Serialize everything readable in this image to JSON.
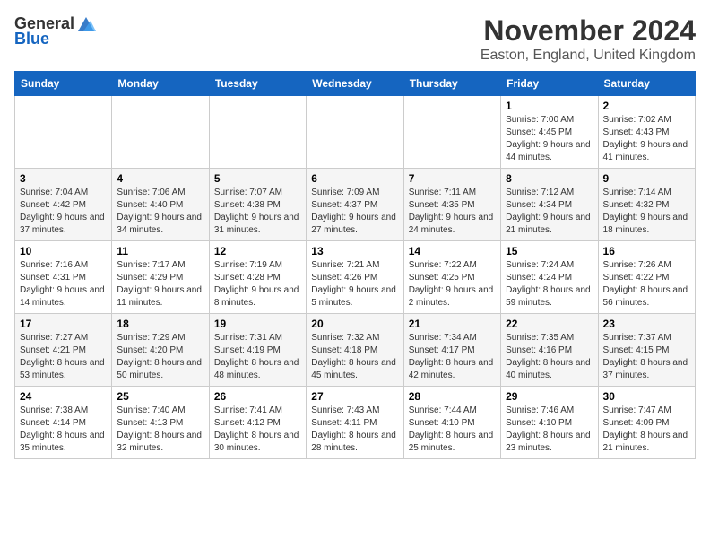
{
  "logo": {
    "general": "General",
    "blue": "Blue"
  },
  "header": {
    "month_year": "November 2024",
    "location": "Easton, England, United Kingdom"
  },
  "days_of_week": [
    "Sunday",
    "Monday",
    "Tuesday",
    "Wednesday",
    "Thursday",
    "Friday",
    "Saturday"
  ],
  "weeks": [
    [
      {
        "day": "",
        "sunrise": "",
        "sunset": "",
        "daylight": ""
      },
      {
        "day": "",
        "sunrise": "",
        "sunset": "",
        "daylight": ""
      },
      {
        "day": "",
        "sunrise": "",
        "sunset": "",
        "daylight": ""
      },
      {
        "day": "",
        "sunrise": "",
        "sunset": "",
        "daylight": ""
      },
      {
        "day": "",
        "sunrise": "",
        "sunset": "",
        "daylight": ""
      },
      {
        "day": "1",
        "sunrise": "Sunrise: 7:00 AM",
        "sunset": "Sunset: 4:45 PM",
        "daylight": "Daylight: 9 hours and 44 minutes."
      },
      {
        "day": "2",
        "sunrise": "Sunrise: 7:02 AM",
        "sunset": "Sunset: 4:43 PM",
        "daylight": "Daylight: 9 hours and 41 minutes."
      }
    ],
    [
      {
        "day": "3",
        "sunrise": "Sunrise: 7:04 AM",
        "sunset": "Sunset: 4:42 PM",
        "daylight": "Daylight: 9 hours and 37 minutes."
      },
      {
        "day": "4",
        "sunrise": "Sunrise: 7:06 AM",
        "sunset": "Sunset: 4:40 PM",
        "daylight": "Daylight: 9 hours and 34 minutes."
      },
      {
        "day": "5",
        "sunrise": "Sunrise: 7:07 AM",
        "sunset": "Sunset: 4:38 PM",
        "daylight": "Daylight: 9 hours and 31 minutes."
      },
      {
        "day": "6",
        "sunrise": "Sunrise: 7:09 AM",
        "sunset": "Sunset: 4:37 PM",
        "daylight": "Daylight: 9 hours and 27 minutes."
      },
      {
        "day": "7",
        "sunrise": "Sunrise: 7:11 AM",
        "sunset": "Sunset: 4:35 PM",
        "daylight": "Daylight: 9 hours and 24 minutes."
      },
      {
        "day": "8",
        "sunrise": "Sunrise: 7:12 AM",
        "sunset": "Sunset: 4:34 PM",
        "daylight": "Daylight: 9 hours and 21 minutes."
      },
      {
        "day": "9",
        "sunrise": "Sunrise: 7:14 AM",
        "sunset": "Sunset: 4:32 PM",
        "daylight": "Daylight: 9 hours and 18 minutes."
      }
    ],
    [
      {
        "day": "10",
        "sunrise": "Sunrise: 7:16 AM",
        "sunset": "Sunset: 4:31 PM",
        "daylight": "Daylight: 9 hours and 14 minutes."
      },
      {
        "day": "11",
        "sunrise": "Sunrise: 7:17 AM",
        "sunset": "Sunset: 4:29 PM",
        "daylight": "Daylight: 9 hours and 11 minutes."
      },
      {
        "day": "12",
        "sunrise": "Sunrise: 7:19 AM",
        "sunset": "Sunset: 4:28 PM",
        "daylight": "Daylight: 9 hours and 8 minutes."
      },
      {
        "day": "13",
        "sunrise": "Sunrise: 7:21 AM",
        "sunset": "Sunset: 4:26 PM",
        "daylight": "Daylight: 9 hours and 5 minutes."
      },
      {
        "day": "14",
        "sunrise": "Sunrise: 7:22 AM",
        "sunset": "Sunset: 4:25 PM",
        "daylight": "Daylight: 9 hours and 2 minutes."
      },
      {
        "day": "15",
        "sunrise": "Sunrise: 7:24 AM",
        "sunset": "Sunset: 4:24 PM",
        "daylight": "Daylight: 8 hours and 59 minutes."
      },
      {
        "day": "16",
        "sunrise": "Sunrise: 7:26 AM",
        "sunset": "Sunset: 4:22 PM",
        "daylight": "Daylight: 8 hours and 56 minutes."
      }
    ],
    [
      {
        "day": "17",
        "sunrise": "Sunrise: 7:27 AM",
        "sunset": "Sunset: 4:21 PM",
        "daylight": "Daylight: 8 hours and 53 minutes."
      },
      {
        "day": "18",
        "sunrise": "Sunrise: 7:29 AM",
        "sunset": "Sunset: 4:20 PM",
        "daylight": "Daylight: 8 hours and 50 minutes."
      },
      {
        "day": "19",
        "sunrise": "Sunrise: 7:31 AM",
        "sunset": "Sunset: 4:19 PM",
        "daylight": "Daylight: 8 hours and 48 minutes."
      },
      {
        "day": "20",
        "sunrise": "Sunrise: 7:32 AM",
        "sunset": "Sunset: 4:18 PM",
        "daylight": "Daylight: 8 hours and 45 minutes."
      },
      {
        "day": "21",
        "sunrise": "Sunrise: 7:34 AM",
        "sunset": "Sunset: 4:17 PM",
        "daylight": "Daylight: 8 hours and 42 minutes."
      },
      {
        "day": "22",
        "sunrise": "Sunrise: 7:35 AM",
        "sunset": "Sunset: 4:16 PM",
        "daylight": "Daylight: 8 hours and 40 minutes."
      },
      {
        "day": "23",
        "sunrise": "Sunrise: 7:37 AM",
        "sunset": "Sunset: 4:15 PM",
        "daylight": "Daylight: 8 hours and 37 minutes."
      }
    ],
    [
      {
        "day": "24",
        "sunrise": "Sunrise: 7:38 AM",
        "sunset": "Sunset: 4:14 PM",
        "daylight": "Daylight: 8 hours and 35 minutes."
      },
      {
        "day": "25",
        "sunrise": "Sunrise: 7:40 AM",
        "sunset": "Sunset: 4:13 PM",
        "daylight": "Daylight: 8 hours and 32 minutes."
      },
      {
        "day": "26",
        "sunrise": "Sunrise: 7:41 AM",
        "sunset": "Sunset: 4:12 PM",
        "daylight": "Daylight: 8 hours and 30 minutes."
      },
      {
        "day": "27",
        "sunrise": "Sunrise: 7:43 AM",
        "sunset": "Sunset: 4:11 PM",
        "daylight": "Daylight: 8 hours and 28 minutes."
      },
      {
        "day": "28",
        "sunrise": "Sunrise: 7:44 AM",
        "sunset": "Sunset: 4:10 PM",
        "daylight": "Daylight: 8 hours and 25 minutes."
      },
      {
        "day": "29",
        "sunrise": "Sunrise: 7:46 AM",
        "sunset": "Sunset: 4:10 PM",
        "daylight": "Daylight: 8 hours and 23 minutes."
      },
      {
        "day": "30",
        "sunrise": "Sunrise: 7:47 AM",
        "sunset": "Sunset: 4:09 PM",
        "daylight": "Daylight: 8 hours and 21 minutes."
      }
    ]
  ]
}
